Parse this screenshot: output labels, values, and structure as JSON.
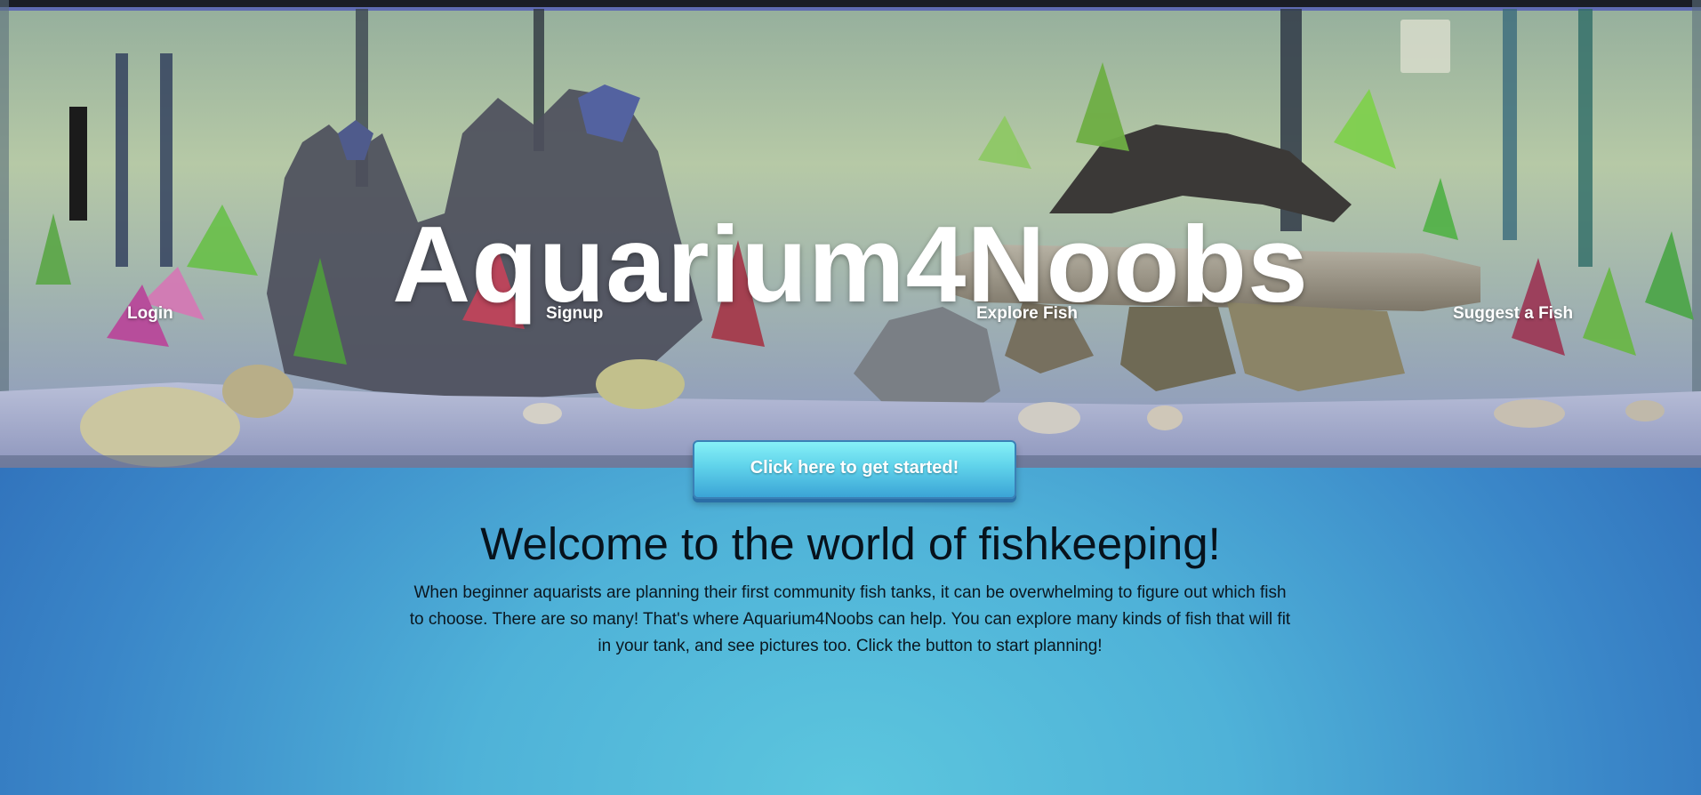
{
  "header": {
    "site_title": "Aquarium4Noobs",
    "hero_image": "aquarium-tank-photo"
  },
  "nav": {
    "items": [
      {
        "label": "Login"
      },
      {
        "label": "Signup"
      },
      {
        "label": "Explore Fish"
      },
      {
        "label": "Suggest a Fish"
      }
    ]
  },
  "cta": {
    "label": "Click here to get started!"
  },
  "main": {
    "heading": "Welcome to the world of fishkeeping!",
    "intro": "When beginner aquarists are planning their first community fish tanks, it can be overwhelming to figure out which fish to choose. There are so many! That's where Aquarium4Noobs can help. You can explore many kinds of fish that will fit in your tank, and see pictures too. Click the button to start planning!"
  },
  "colors": {
    "background_center": "#5cc6de",
    "background_edge": "#2456aa",
    "button_top": "#86f0f7",
    "button_bottom": "#3ba4d6",
    "text_light": "#ffffff",
    "text_dark": "#07121c"
  }
}
